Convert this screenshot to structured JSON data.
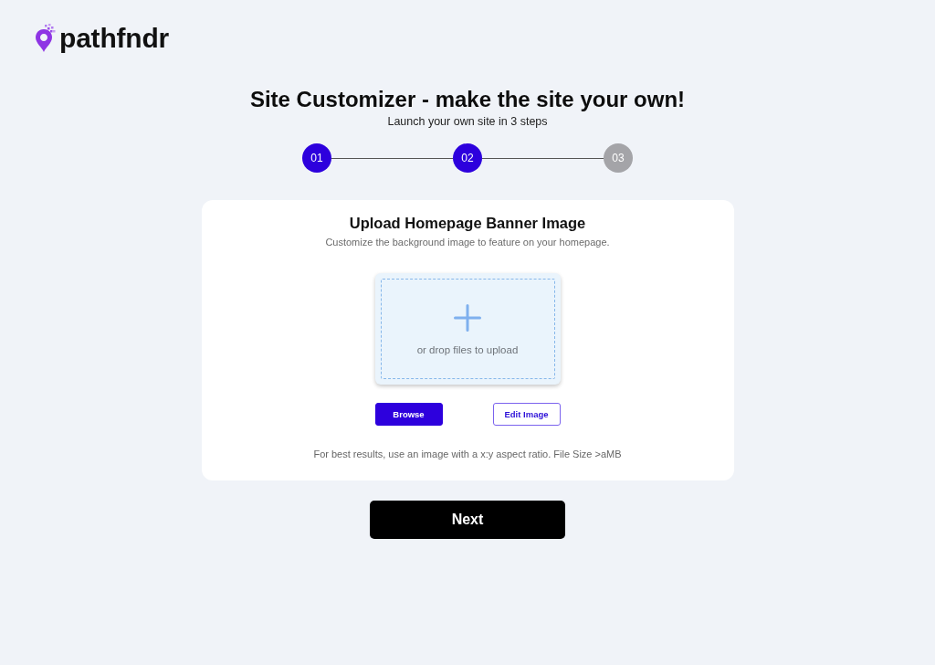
{
  "logo": {
    "text": "pathfndr"
  },
  "header": {
    "title": "Site Customizer - make the site your own!",
    "subtitle": "Launch your own site in 3 steps"
  },
  "steps": [
    {
      "label": "01",
      "completed": true
    },
    {
      "label": "02",
      "completed": true
    },
    {
      "label": "03",
      "completed": false
    }
  ],
  "card": {
    "title": "Upload Homepage Banner Image",
    "subtitle": "Customize the background image to feature on your homepage.",
    "dropzone": {
      "text": "or drop files to upload"
    },
    "buttons": [
      {
        "label": "Browse",
        "kind": "primary"
      },
      {
        "label": "Edit Image",
        "kind": "outline"
      }
    ],
    "note": "For best results, use an image with a x:y aspect ratio. File Size >aMB"
  },
  "next_button": {
    "label": "Next"
  }
}
